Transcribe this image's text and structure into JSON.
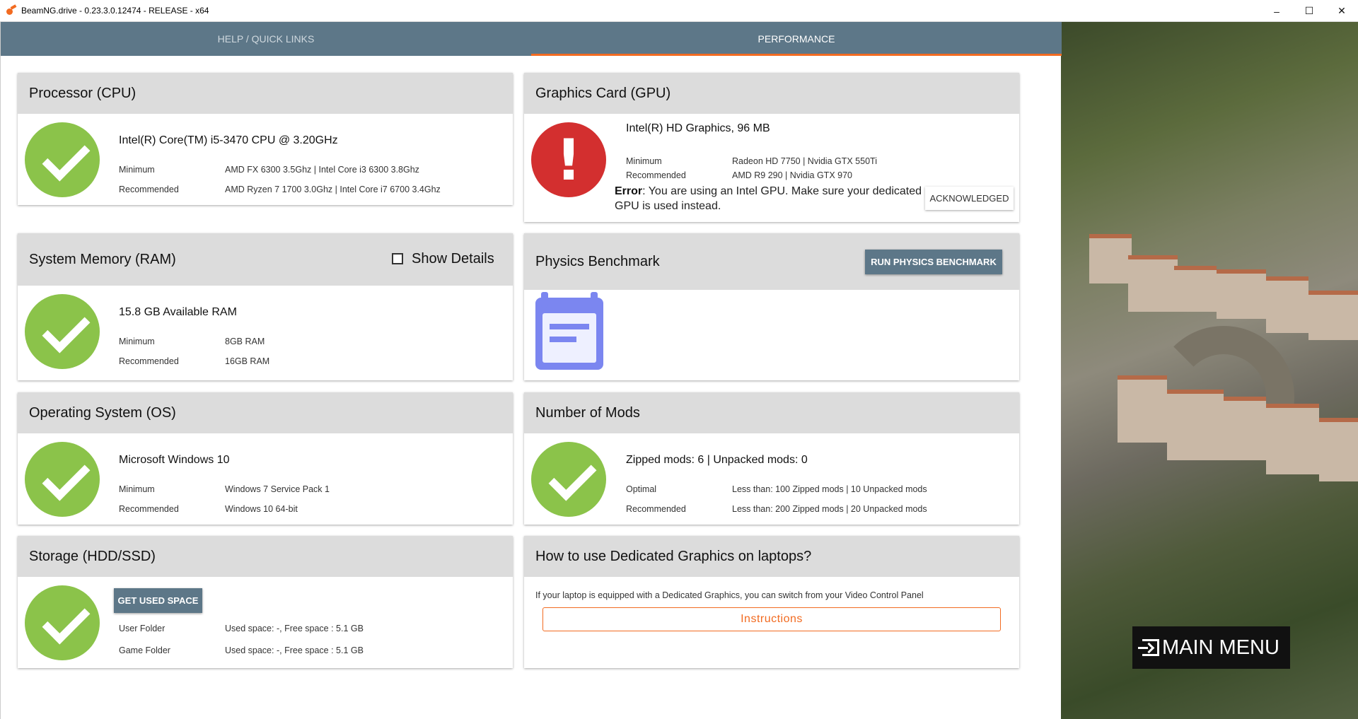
{
  "window": {
    "title": "BeamNG.drive - 0.23.3.0.12474 - RELEASE - x64"
  },
  "tabs": [
    {
      "label": "HELP / QUICK LINKS"
    },
    {
      "label": "PERFORMANCE"
    }
  ],
  "cpu": {
    "title": "Processor (CPU)",
    "value": "Intel(R) Core(TM) i5-3470 CPU @ 3.20GHz",
    "min_label": "Minimum",
    "min_value": "AMD FX 6300 3.5Ghz | Intel Core i3 6300 3.8Ghz",
    "rec_label": "Recommended",
    "rec_value": "AMD Ryzen 7 1700 3.0Ghz | Intel Core i7 6700 3.4Ghz"
  },
  "gpu": {
    "title": "Graphics Card (GPU)",
    "value": "Intel(R) HD Graphics, 96 MB",
    "min_label": "Minimum",
    "min_value": "Radeon HD 7750 | Nvidia GTX 550Ti",
    "rec_label": "Recommended",
    "rec_value": "AMD R9 290 | Nvidia GTX 970",
    "error_label": "Error",
    "error_text": ": You are using an Intel GPU. Make sure your dedicated GPU is used instead.",
    "ack_button": "ACKNOWLEDGED"
  },
  "ram": {
    "title": "System Memory (RAM)",
    "show_details": "Show Details",
    "value": "15.8 GB Available RAM",
    "min_label": "Minimum",
    "min_value": "8GB RAM",
    "rec_label": "Recommended",
    "rec_value": "16GB RAM"
  },
  "physics": {
    "title": "Physics Benchmark",
    "run_button": "RUN PHYSICS BENCHMARK"
  },
  "os": {
    "title": "Operating System (OS)",
    "value": "Microsoft Windows 10",
    "min_label": "Minimum",
    "min_value": "Windows 7 Service Pack 1",
    "rec_label": "Recommended",
    "rec_value": "Windows 10 64-bit"
  },
  "mods": {
    "title": "Number of Mods",
    "value": "Zipped mods: 6 | Unpacked mods: 0",
    "opt_label": "Optimal",
    "opt_value": "Less than: 100 Zipped mods | 10 Unpacked mods",
    "rec_label": "Recommended",
    "rec_value": "Less than: 200 Zipped mods | 20 Unpacked mods"
  },
  "storage": {
    "title": "Storage (HDD/SSD)",
    "button": "GET USED SPACE",
    "user_label": "User Folder",
    "user_value": "Used space: -, Free space : 5.1 GB",
    "game_label": "Game Folder",
    "game_value": "Used space: -, Free space : 5.1 GB"
  },
  "laptop": {
    "title": "How to use Dedicated Graphics on laptops?",
    "text": "If your laptop is equipped with a Dedicated Graphics, you can switch from your Video Control Panel",
    "button": "Instructions"
  },
  "main_menu": {
    "label": "MAIN MENU"
  },
  "colors": {
    "accent": "#f26b21",
    "tab_bar": "#5d7788",
    "ok": "#8bc34a",
    "error": "#d32f2f",
    "notepad": "#7b86f0"
  }
}
